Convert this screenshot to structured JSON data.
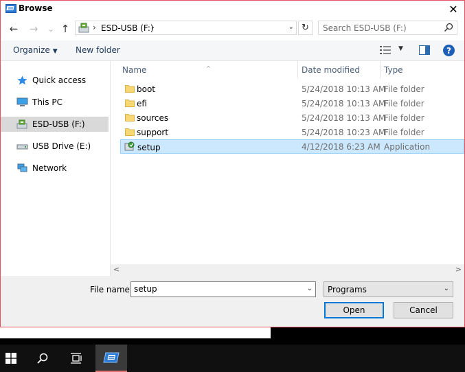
{
  "window": {
    "title": "Browse",
    "icon": "setup-app-icon",
    "close_glyph": "✕"
  },
  "nav": {
    "back_glyph": "←",
    "forward_glyph": "→",
    "recent_glyph": "⌄",
    "up_glyph": "↑",
    "address": {
      "drive_icon": "usb-drive-icon",
      "sep": "›",
      "crumb": "ESD-USB (F:)",
      "dropdown_glyph": "⌄"
    },
    "refresh_glyph": "↻",
    "search_placeholder": "Search ESD-USB (F:)"
  },
  "toolbar": {
    "organize": "Organize",
    "organize_arrow": "▼",
    "new_folder": "New folder",
    "view_arrow": "▼",
    "help": "?"
  },
  "sidebar": {
    "items": [
      {
        "label": "Quick access",
        "icon": "star-icon"
      },
      {
        "label": "This PC",
        "icon": "computer-icon"
      },
      {
        "label": "ESD-USB (F:)",
        "icon": "usb-drive-icon",
        "selected": true
      },
      {
        "label": "USB Drive (E:)",
        "icon": "usb-drive-e-icon"
      },
      {
        "label": "Network",
        "icon": "network-icon"
      }
    ]
  },
  "list": {
    "columns": [
      "Name",
      "Date modified",
      "Type"
    ],
    "sort_glyph": "^",
    "rows": [
      {
        "name": "boot",
        "date": "5/24/2018 10:13 AM",
        "type": "File folder",
        "icon": "folder-icon"
      },
      {
        "name": "efi",
        "date": "5/24/2018 10:13 AM",
        "type": "File folder",
        "icon": "folder-icon"
      },
      {
        "name": "sources",
        "date": "5/24/2018 10:13 AM",
        "type": "File folder",
        "icon": "folder-icon"
      },
      {
        "name": "support",
        "date": "5/24/2018 10:23 AM",
        "type": "File folder",
        "icon": "folder-icon"
      },
      {
        "name": "setup",
        "date": "4/12/2018 6:23 AM",
        "type": "Application",
        "icon": "setup-app-icon",
        "selected": true
      }
    ]
  },
  "scroll": {
    "left": "<",
    "right": ">"
  },
  "footer": {
    "file_name_label": "File name:",
    "file_name_value": "setup",
    "file_type": "Programs",
    "dropdown_glyph": "⌄",
    "open": "Open",
    "cancel": "Cancel"
  },
  "colors": {
    "accent": "#0078d7",
    "selection": "#cce8ff",
    "window_border": "#e8505b",
    "taskbar": "#101010"
  }
}
